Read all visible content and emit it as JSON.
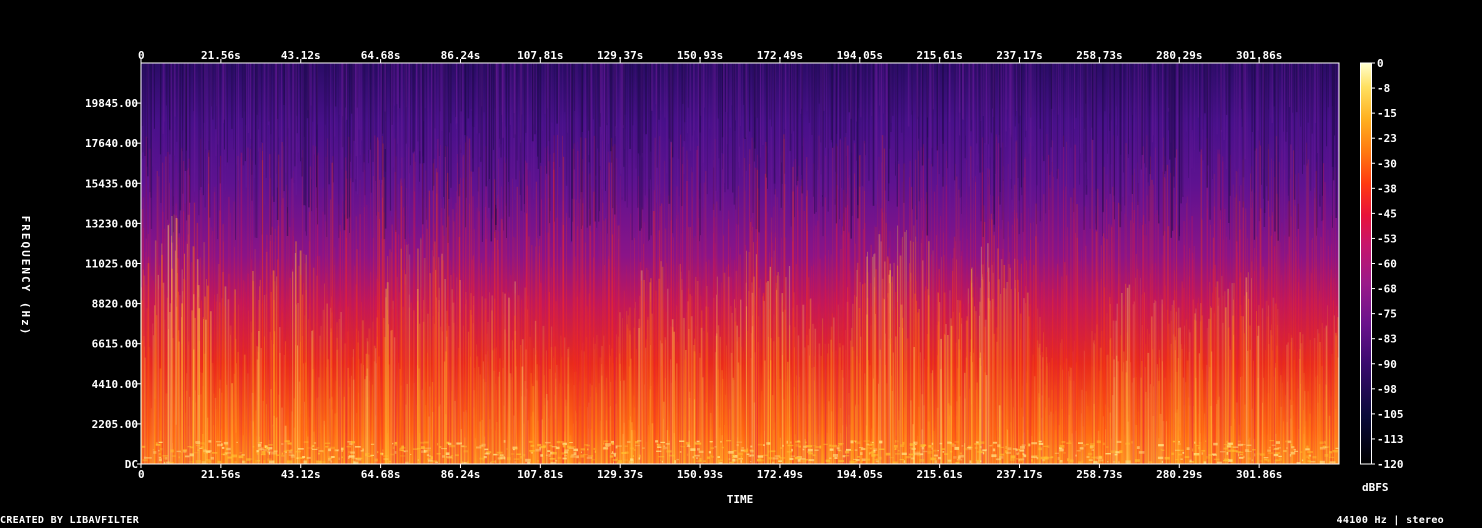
{
  "chart_data": {
    "type": "heatmap",
    "title": "",
    "xlabel": "TIME",
    "ylabel": "FREQUENCY (Hz)",
    "x_ticks": [
      "0",
      "21.56s",
      "43.12s",
      "64.68s",
      "86.24s",
      "107.81s",
      "129.37s",
      "150.93s",
      "172.49s",
      "194.05s",
      "215.61s",
      "237.17s",
      "258.73s",
      "280.29s",
      "301.86s"
    ],
    "x_tick_step_seconds": 21.56,
    "xlim": [
      0,
      323.4
    ],
    "y_ticks": [
      "DC",
      "2205.00",
      "4410.00",
      "6615.00",
      "8820.00",
      "11025.00",
      "13230.00",
      "15435.00",
      "17640.00",
      "19845.00"
    ],
    "ylim": [
      0,
      22050
    ],
    "colorbar": {
      "label": "dBFS",
      "ticks": [
        "0",
        "-8",
        "-15",
        "-23",
        "-30",
        "-38",
        "-45",
        "-53",
        "-60",
        "-68",
        "-75",
        "-83",
        "-90",
        "-98",
        "-105",
        "-113",
        "-120"
      ],
      "range": [
        -120,
        0
      ],
      "colormap": [
        "#000000",
        "#0a0a3a",
        "#3a0a6e",
        "#6a128c",
        "#9a1a8a",
        "#c8156a",
        "#e8123a",
        "#ff3a10",
        "#ff7a10",
        "#ffb020",
        "#ffe060",
        "#ffffd0"
      ]
    }
  },
  "footer": {
    "left": "CREATED BY LIBAVFILTER",
    "right": "44100 Hz | stereo"
  }
}
